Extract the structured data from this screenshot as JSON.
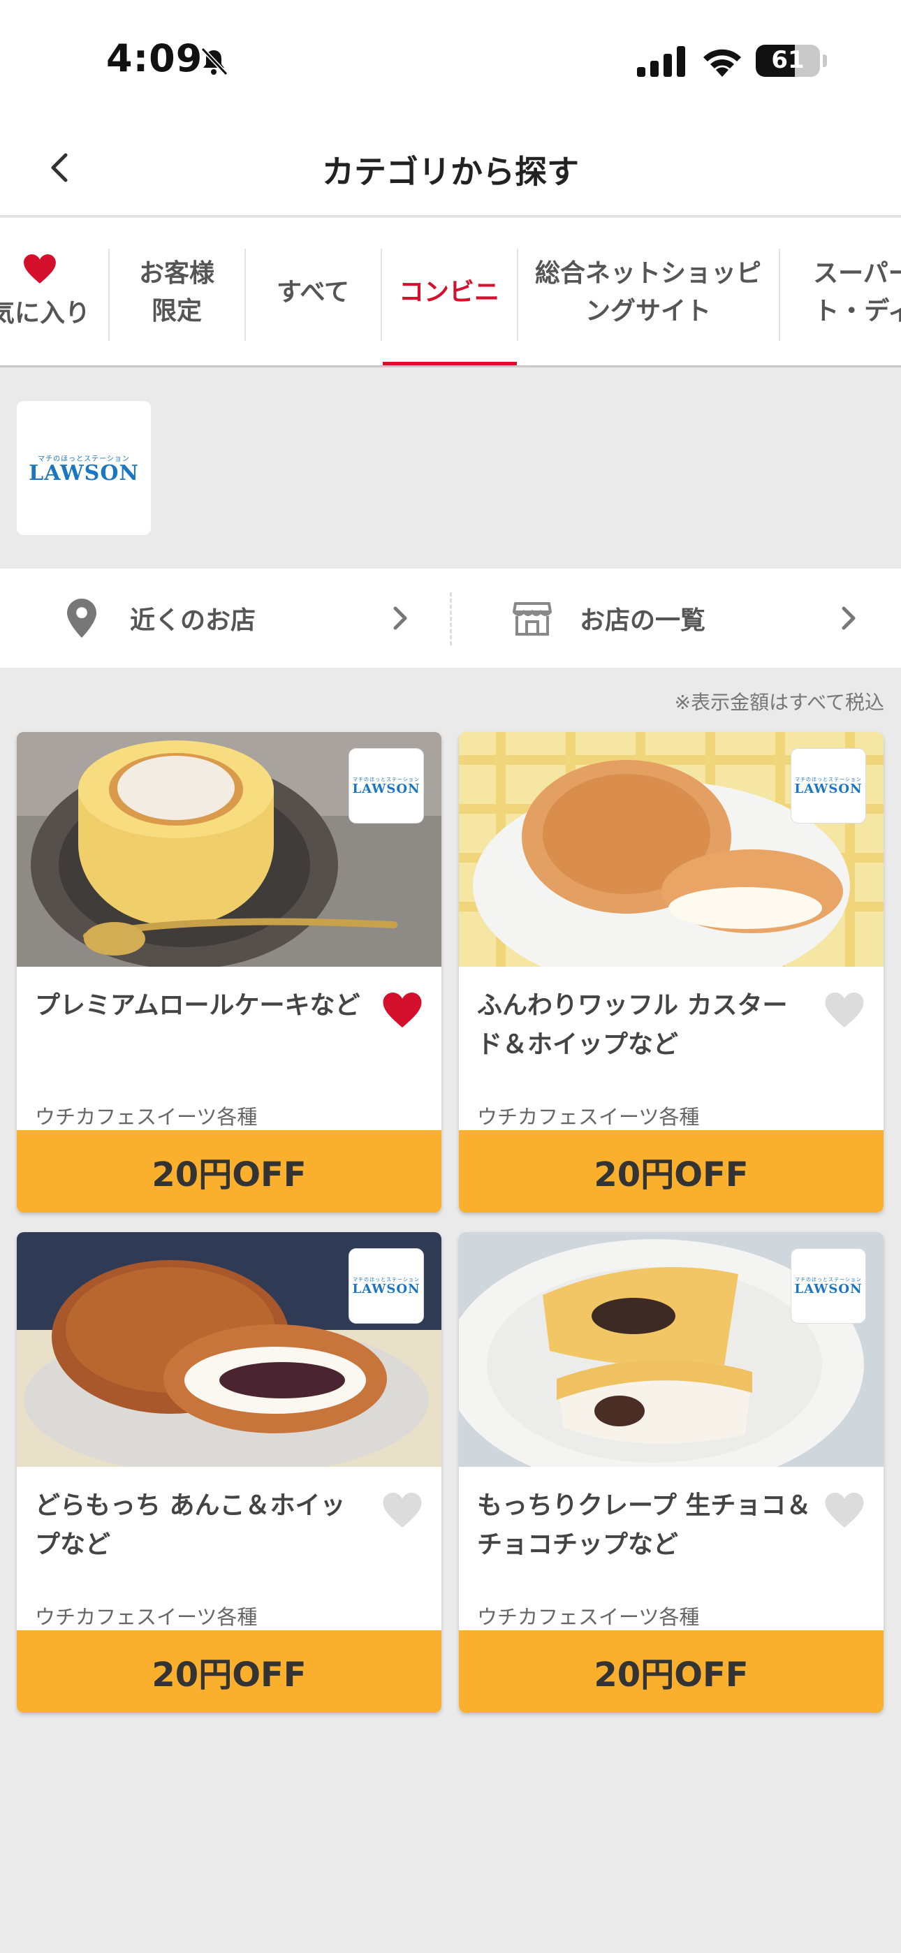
{
  "status_bar": {
    "time": "4:09",
    "battery": "61",
    "battery_level": 0.61
  },
  "header": {
    "title": "カテゴリから探す"
  },
  "tabs": [
    {
      "label": "気に入り"
    },
    {
      "label": "お客様\n限定"
    },
    {
      "label": "すべて"
    },
    {
      "label": "コンビニ"
    },
    {
      "label": "総合ネットショッピ\nングサイト"
    },
    {
      "label": "スーパー\nト・ディ"
    }
  ],
  "store": {
    "logo_sub": "マチのほっとステーション",
    "logo_word": "LAWSON"
  },
  "links": {
    "nearby": "近くのお店",
    "list": "お店の一覧"
  },
  "tax_note": "※表示金額はすべて税込",
  "cards": [
    {
      "name": "プレミアムロールケーキなど",
      "sub": "ウチカフェスイーツ各種",
      "offer": "20円OFF",
      "favorite": true
    },
    {
      "name": "ふんわりワッフル カスタード＆ホイップなど",
      "sub": "ウチカフェスイーツ各種",
      "offer": "20円OFF",
      "favorite": false
    },
    {
      "name": "どらもっち あんこ＆ホイップなど",
      "sub": "ウチカフェスイーツ各種",
      "offer": "20円OFF",
      "favorite": false
    },
    {
      "name": "もっちりクレープ 生チョコ＆チョコチップなど",
      "sub": "ウチカフェスイーツ各種",
      "offer": "20円OFF",
      "favorite": false
    }
  ],
  "colors": {
    "accent": "#d4102c",
    "offer": "#fbb02d",
    "logo": "#1a76c2"
  }
}
